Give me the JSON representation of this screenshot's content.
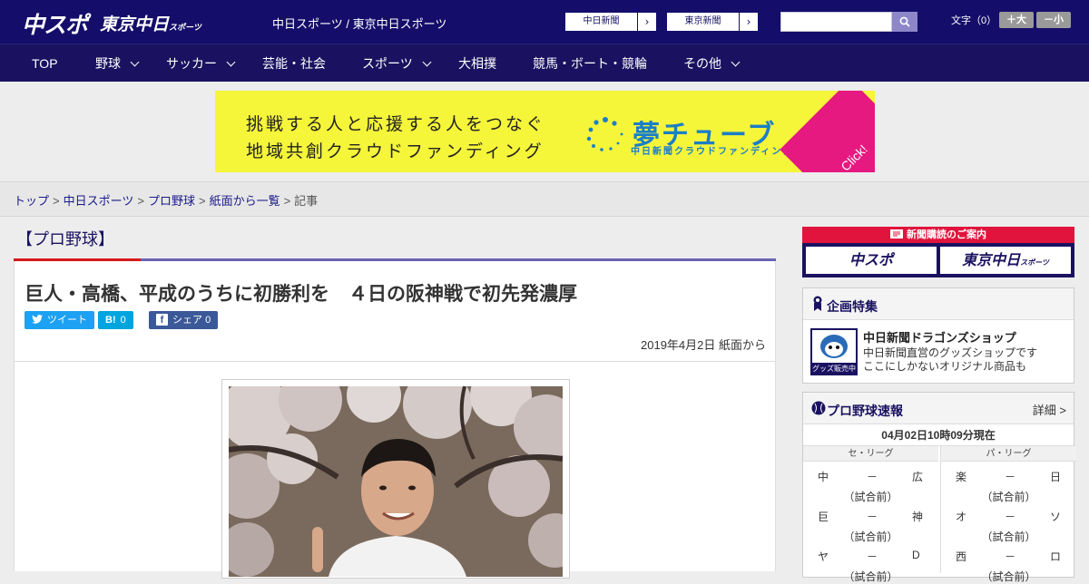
{
  "header": {
    "logo_chuspo": "中スポ",
    "logo_tokyo": "東京中日",
    "logo_tokyo_small": "スポーツ",
    "site_title": "中日スポーツ / 東京中日スポーツ",
    "paper_buttons": [
      {
        "label": "中日新聞",
        "arrow": "›"
      },
      {
        "label": "東京新聞",
        "arrow": "›"
      }
    ],
    "search_placeholder": "",
    "font_size_label": "文字（0）",
    "font_up": "＋大",
    "font_down": "－小"
  },
  "nav": {
    "items": [
      {
        "label": "TOP",
        "dropdown": false
      },
      {
        "label": "野球",
        "dropdown": true
      },
      {
        "label": "サッカー",
        "dropdown": true
      },
      {
        "label": "芸能・社会",
        "dropdown": false
      },
      {
        "label": "スポーツ",
        "dropdown": true
      },
      {
        "label": "大相撲",
        "dropdown": false
      },
      {
        "label": "競馬・ボート・競輪",
        "dropdown": false
      },
      {
        "label": "その他",
        "dropdown": true
      }
    ]
  },
  "banner": {
    "line1": "挑戦する人と応援する人をつなぐ",
    "line2": "地域共創クラウドファンディング",
    "brand": "夢チューブ",
    "brand_sub": "中日新聞クラウドファンディング",
    "click": "Click!",
    "colors": {
      "bg": "#f5f53a",
      "brand": "#1a7ec8",
      "corner": "#e5197f"
    }
  },
  "breadcrumb": {
    "items": [
      "トップ",
      "中日スポーツ",
      "プロ野球",
      "紙面から一覧"
    ],
    "current": "記事",
    "separator": ">"
  },
  "article": {
    "category": "【プロ野球】",
    "headline": "巨人・高橋、平成のうちに初勝利を　４日の阪神戦で初先発濃厚",
    "share": {
      "tweet": "ツイート",
      "hatena_icon": "B!",
      "hatena_count": "0",
      "facebook": "シェア",
      "facebook_count": "0"
    },
    "date": "2019年4月2日 紙面から"
  },
  "sidebar": {
    "subscription": {
      "title": "新聞購読のご案内",
      "buttons": [
        "中スポ",
        "東京中日"
      ],
      "tokyo_small": "スポーツ"
    },
    "feature": {
      "title": "企画特集",
      "item_title": "中日新聞ドラゴンズショップ",
      "item_desc_1": "中日新聞直営のグッズショップです",
      "item_desc_2": "ここにしかないオリジナル商品も",
      "logo_text": "グッズ販売中"
    },
    "scores": {
      "title": "プロ野球速報",
      "more": "詳細 >",
      "time": "04月02日10時09分現在",
      "central_label": "セ・リーグ",
      "pacific_label": "パ・リーグ",
      "central": [
        {
          "home": "中",
          "vs": "－",
          "away": "広",
          "status": "（試合前）"
        },
        {
          "home": "巨",
          "vs": "－",
          "away": "神",
          "status": "（試合前）"
        },
        {
          "home": "ヤ",
          "vs": "－",
          "away": "D",
          "status": "（試合前）"
        }
      ],
      "pacific": [
        {
          "home": "楽",
          "vs": "－",
          "away": "日",
          "status": "（試合前）"
        },
        {
          "home": "オ",
          "vs": "－",
          "away": "ソ",
          "status": "（試合前）"
        },
        {
          "home": "西",
          "vs": "－",
          "away": "ロ",
          "status": "（試合前）"
        }
      ]
    }
  },
  "colors": {
    "header_bg": "#140e6a",
    "nav_bg": "#1a1260",
    "accent_red": "#d71a1a",
    "twitter": "#1da1f2",
    "hatena": "#00a4de",
    "facebook": "#3b5998"
  }
}
